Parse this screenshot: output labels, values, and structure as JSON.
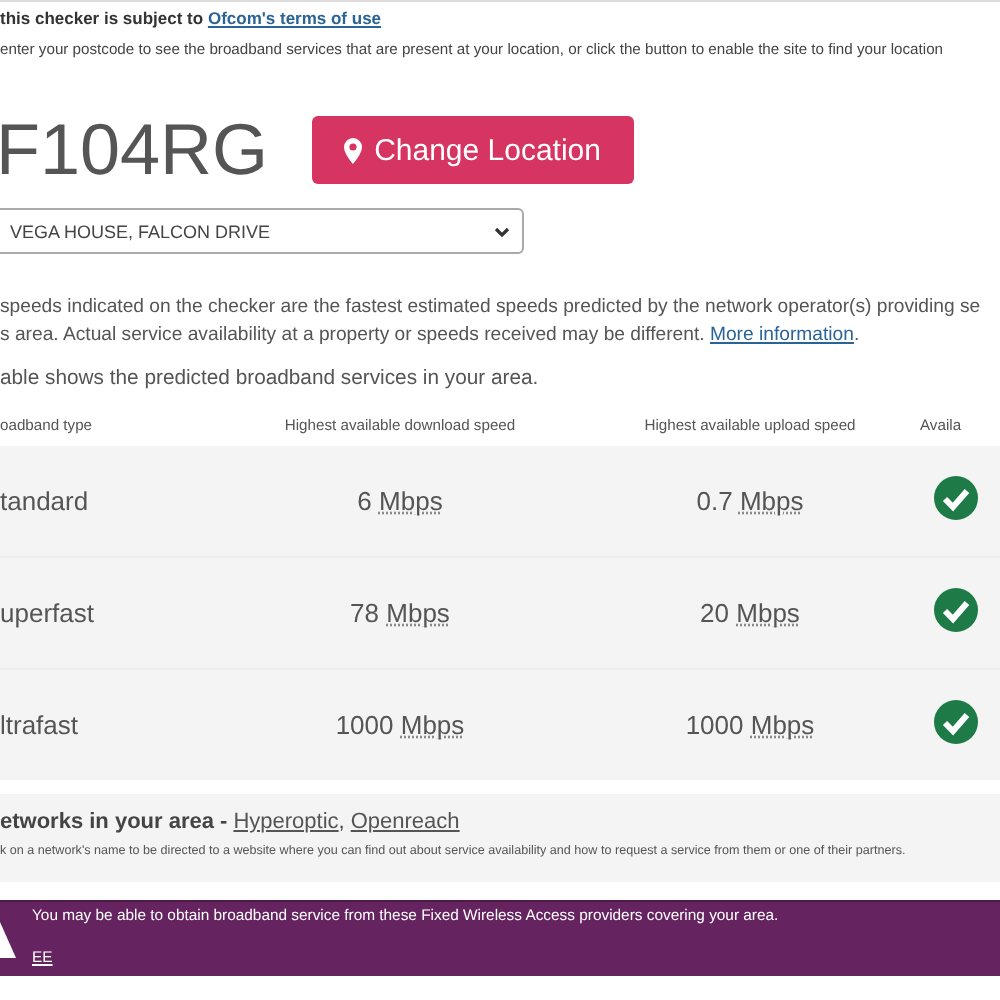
{
  "terms": {
    "text": "this checker is subject to",
    "link": "Ofcom's terms of use"
  },
  "instruction": "enter your postcode to see the broadband services that are present at your location, or click the button to enable the site to find your location",
  "postcode": "F104RG",
  "change_button": "Change Location",
  "address_select": {
    "value": "VEGA HOUSE, FALCON DRIVE"
  },
  "disclaimer": {
    "line_1": "speeds indicated on the checker are the fastest estimated speeds predicted by the network operator(s) providing se",
    "line_2": "s area. Actual service availability at a property or speeds received may be different.",
    "link": "More information",
    "end": "."
  },
  "table_intro": "able shows the predicted broadband services in your area.",
  "table": {
    "columns": [
      "oadband type",
      "Highest available download speed",
      "Highest available upload speed",
      "Availa"
    ],
    "rows": [
      {
        "type": "tandard",
        "download": {
          "value": "6",
          "unit": "Mbps"
        },
        "upload": {
          "value": "0.7",
          "unit": "Mbps"
        },
        "available": true
      },
      {
        "type": "uperfast",
        "download": {
          "value": "78",
          "unit": "Mbps"
        },
        "upload": {
          "value": "20",
          "unit": "Mbps"
        },
        "available": true
      },
      {
        "type": "ltrafast",
        "download": {
          "value": "1000",
          "unit": "Mbps"
        },
        "upload": {
          "value": "1000",
          "unit": "Mbps"
        },
        "available": true
      }
    ]
  },
  "networks": {
    "heading": "etworks in your area -",
    "links": [
      "Hyperoptic",
      "Openreach"
    ],
    "separator": ",",
    "note": "k on a network's name to be directed to a website where you can find out about service availability and how to request a service from them or one of their partners."
  },
  "fwa_banner": {
    "text": "You may be able to obtain broadband service from these Fixed Wireless Access providers covering your area.",
    "providers": [
      "EE"
    ]
  }
}
